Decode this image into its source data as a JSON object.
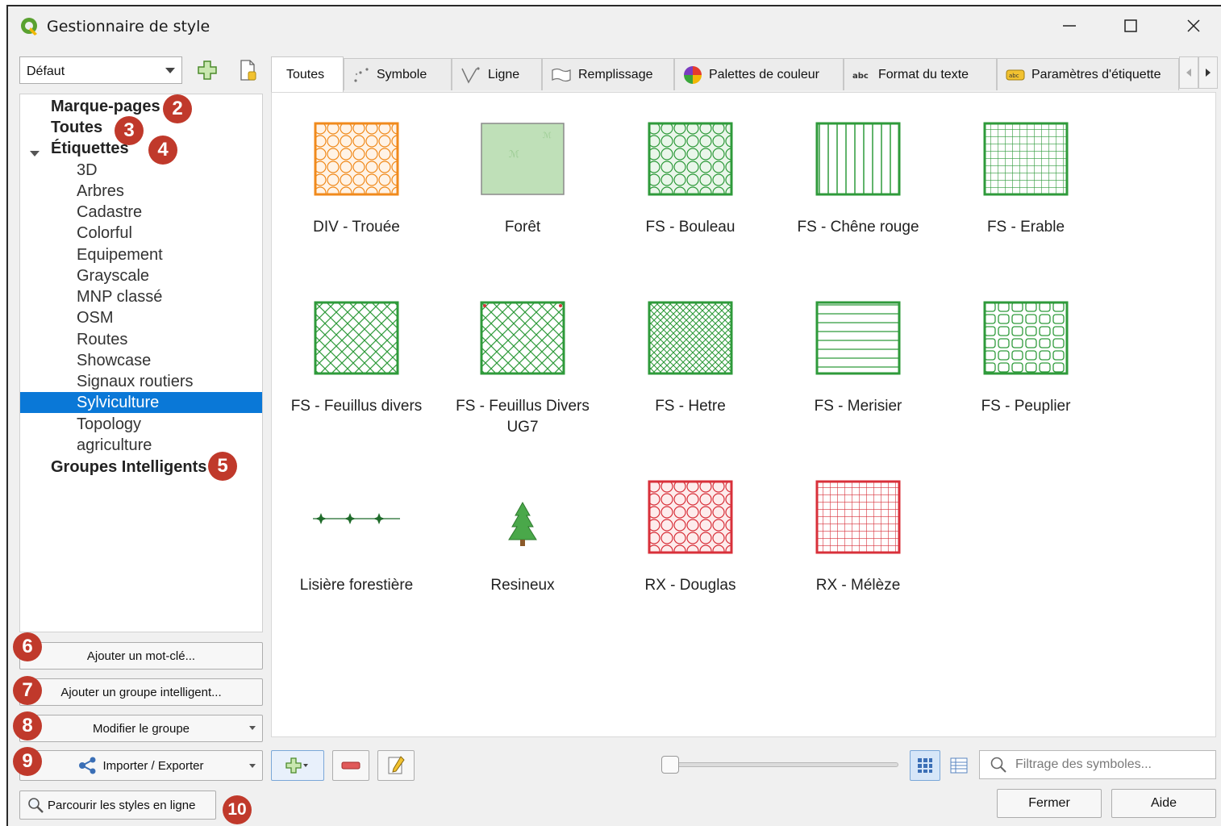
{
  "window": {
    "title": "Gestionnaire de style",
    "minimize_icon": "minimize-icon",
    "maximize_icon": "maximize-icon",
    "close_icon": "close-icon"
  },
  "library_combo": {
    "value": "Défaut"
  },
  "tree": {
    "bookmarks": "Marque-pages",
    "all": "Toutes",
    "tags": "Étiquettes",
    "tag_items": [
      "3D",
      "Arbres",
      "Cadastre",
      "Colorful",
      "Equipement",
      "Grayscale",
      "MNP classé",
      "OSM",
      "Routes",
      "Showcase",
      "Signaux routiers",
      "Sylviculture",
      "Topology",
      "agriculture"
    ],
    "selected_tag": "Sylviculture",
    "smart_groups": "Groupes Intelligents"
  },
  "badges": [
    "2",
    "3",
    "4",
    "5",
    "6",
    "7",
    "8",
    "9",
    "10"
  ],
  "left_buttons": {
    "add_keyword": "Ajouter un mot-clé...",
    "add_smart_group": "Ajouter un groupe intelligent...",
    "modify_group": "Modifier le groupe",
    "import_export": "Importer / Exporter",
    "browse_online": "Parcourir les styles en ligne"
  },
  "tabs": [
    {
      "label": "Toutes",
      "icon": "",
      "active": true
    },
    {
      "label": "Symbole",
      "icon": "symbol-dots-icon"
    },
    {
      "label": "Ligne",
      "icon": "line-icon"
    },
    {
      "label": "Remplissage",
      "icon": "fill-icon"
    },
    {
      "label": "Palettes de couleur",
      "icon": "color-wheel-icon"
    },
    {
      "label": "Format du texte",
      "icon": "text-format-icon"
    },
    {
      "label": "Paramètres d'étiquette",
      "icon": "label-settings-icon"
    }
  ],
  "symbols": [
    {
      "name": "DIV - Trouée",
      "color": "#f08a1c"
    },
    {
      "name": "Forêt",
      "color": "#a8d5a0"
    },
    {
      "name": "FS - Bouleau",
      "color": "#2e9a3a"
    },
    {
      "name": "FS - Chêne rouge",
      "color": "#2e9a3a"
    },
    {
      "name": "FS - Erable",
      "color": "#2e9a3a"
    },
    {
      "name": "FS - Feuillus divers",
      "color": "#2e9a3a"
    },
    {
      "name": "FS - Feuillus Divers UG7",
      "color": "#2e9a3a"
    },
    {
      "name": "FS - Hetre",
      "color": "#2e9a3a"
    },
    {
      "name": "FS - Merisier",
      "color": "#2e9a3a"
    },
    {
      "name": "FS - Peuplier",
      "color": "#2e9a3a"
    },
    {
      "name": "Lisière forestière",
      "color": "#1f6b2a"
    },
    {
      "name": "Resineux",
      "color": "#3a9a3a"
    },
    {
      "name": "RX - Douglas",
      "color": "#d8303a"
    },
    {
      "name": "RX - Mélèze",
      "color": "#d8303a"
    }
  ],
  "search": {
    "placeholder": "Filtrage des symboles..."
  },
  "footer": {
    "close": "Fermer",
    "help": "Aide"
  }
}
